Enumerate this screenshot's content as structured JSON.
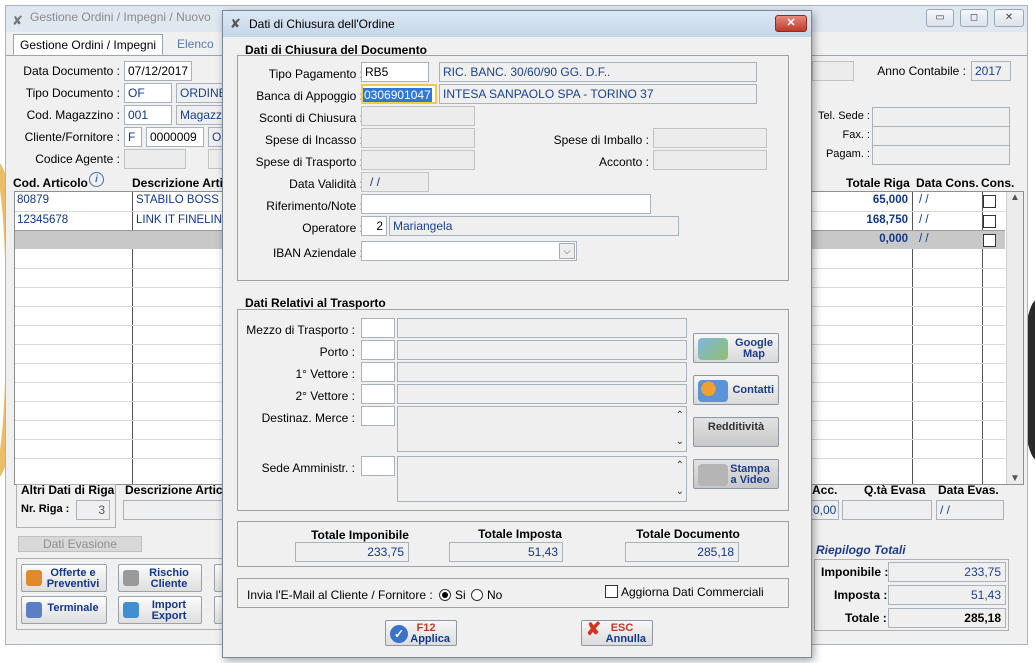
{
  "main": {
    "title": "Gestione Ordini / Impegni / Nuovo",
    "tabs": [
      "Gestione Ordini / Impegni",
      "Elenco"
    ],
    "data_documento_label": "Data Documento :",
    "data_documento": "07/12/2017",
    "tipo_documento_label": "Tipo Documento :",
    "tipo_documento_code": "OF",
    "tipo_documento_desc": "ORDINE",
    "cod_magazzino_label": "Cod. Magazzino :",
    "cod_magazzino_code": "001",
    "cod_magazzino_desc": "Magazzi",
    "cliente_label": "Cliente/Fornitore :",
    "cliente_type": "F",
    "cliente_code": "0000009",
    "cliente_desc": "OF",
    "agente_label": "Codice Agente :",
    "anno_label": "Anno Contabile :",
    "anno": "2017",
    "tel_label": "Tel. Sede :",
    "fax_label": "Fax. :",
    "pagam_label": "Pagam. :",
    "grid": {
      "headers": {
        "cod": "Cod. Articolo",
        "desc": "Descrizione Arti",
        "totale": "Totale Riga",
        "data_cons": "Data Cons.",
        "cons": "Cons."
      },
      "rows": [
        {
          "cod": "80879",
          "desc": "STABILO BOSS",
          "totale": "65,000",
          "data_cons": "/ /"
        },
        {
          "cod": "12345678",
          "desc": "LINK IT FINELIN",
          "totale": "168,750",
          "data_cons": "/ /"
        },
        {
          "cod": "",
          "desc": "",
          "totale": "0,000",
          "data_cons": "/ /"
        }
      ]
    },
    "altri_dati_label": "Altri Dati di Riga",
    "descrizione_artic_label": "Descrizione Artic",
    "nr_riga_label": "Nr. Riga :",
    "nr_riga": "3",
    "acc_label": "Acc.",
    "acc_value": "0,00",
    "qta_evasa_label": "Q.tà Evasa",
    "data_evas_label": "Data Evas.",
    "data_evas": "/ /",
    "dati_evasione_label": "Dati Evasione",
    "buttons": {
      "offerte": "Offerte e Preventivi",
      "rischio": "Rischio Cliente",
      "terminale": "Terminale",
      "import": "Import Export"
    },
    "riepilogo": {
      "title": "Riepilogo Totali",
      "imponibile_label": "Imponibile :",
      "imponibile": "233,75",
      "imposta_label": "Imposta :",
      "imposta": "51,43",
      "totale_label": "Totale :",
      "totale": "285,18"
    }
  },
  "dialog": {
    "title": "Dati di Chiusura dell'Ordine",
    "section1": "Dati di Chiusura del Documento",
    "tipo_pagamento_label": "Tipo Pagamento :",
    "tipo_pagamento_code": "RB5",
    "tipo_pagamento_desc": "RIC. BANC. 30/60/90 GG. D.F..",
    "banca_label": "Banca di Appoggio :",
    "banca_code": "0306901047",
    "banca_desc": "INTESA SANPAOLO SPA - TORINO 37",
    "sconti_label": "Sconti di Chiusura :",
    "spese_incasso_label": "Spese di Incasso :",
    "spese_imballo_label": "Spese di Imballo :",
    "spese_trasporto_label": "Spese di Trasporto :",
    "acconto_label": "Acconto :",
    "data_validita_label": "Data Validità :",
    "data_validita": "/ /",
    "riferimento_label": "Riferimento/Note :",
    "operatore_label": "Operatore :",
    "operatore_code": "2",
    "operatore_name": "Mariangela",
    "iban_label": "IBAN Aziendale :",
    "section2": "Dati Relativi al Trasporto",
    "mezzo_label": "Mezzo di Trasporto :",
    "porto_label": "Porto :",
    "vettore1_label": "1° Vettore :",
    "vettore2_label": "2° Vettore :",
    "destinaz_label": "Destinaz. Merce :",
    "sede_label": "Sede Amministr. :",
    "google_map": "Google Map",
    "contatti": "Contatti",
    "redditivita": "Redditività",
    "stampa_video": "Stampa a Video",
    "totale_imponibile_label": "Totale Imponibile",
    "totale_imponibile": "233,75",
    "totale_imposta_label": "Totale Imposta",
    "totale_imposta": "51,43",
    "totale_documento_label": "Totale Documento",
    "totale_documento": "285,18",
    "email_label": "Invia l'E-Mail al Cliente / Fornitore :",
    "si_label": "Si",
    "no_label": "No",
    "aggiorna_label": "Aggiorna Dati Commerciali",
    "applica_key": "F12",
    "applica_label": "Applica",
    "annulla_key": "ESC",
    "annulla_label": "Annulla"
  }
}
